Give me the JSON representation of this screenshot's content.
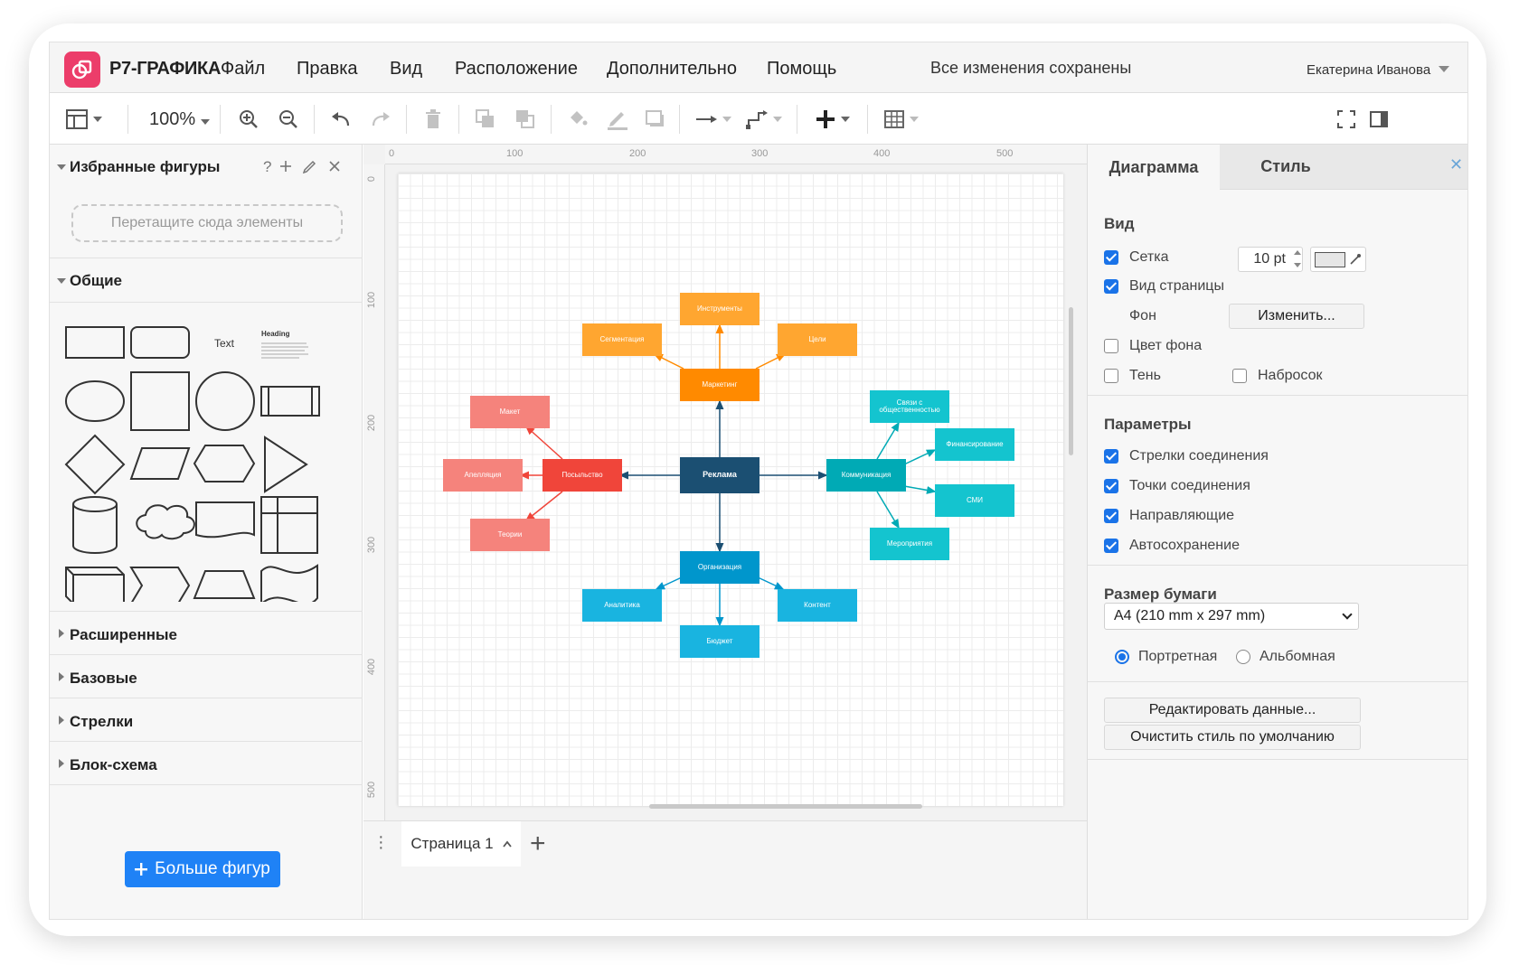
{
  "app": {
    "name": "Р7-ГРАФИКА",
    "save_status": "Все изменения сохранены",
    "user_name": "Екатерина Иванова"
  },
  "menu": [
    "Файл",
    "Правка",
    "Вид",
    "Расположение",
    "Дополнительно",
    "Помощь"
  ],
  "toolbar": {
    "zoom": "100%"
  },
  "left_panel": {
    "favorites_title": "Избранные фигуры",
    "help_glyph": "?",
    "drop_placeholder": "Перетащите сюда элементы",
    "general_title": "Общие",
    "text_shape_label": "Text",
    "heading_shape_label": "Heading",
    "collapsed_sections": [
      "Расширенные",
      "Базовые",
      "Стрелки",
      "Блок-схема"
    ],
    "more_shapes_button": "Больше фигур"
  },
  "ruler": {
    "top": [
      "0",
      "100",
      "200",
      "300",
      "400",
      "500"
    ],
    "left": [
      "0",
      "100",
      "200",
      "300",
      "400",
      "500"
    ]
  },
  "diagram": {
    "center": "Реклама",
    "marketing": "Маркетинг",
    "marketing_children": [
      "Инструменты",
      "Сегментация",
      "Цели"
    ],
    "message": "Посыльство",
    "message_children": [
      "Макет",
      "Апелляция",
      "Теории"
    ],
    "communication": "Коммуникация",
    "communication_children": [
      "Связи с общественностью",
      "Финансирование",
      "СМИ",
      "Мероприятия"
    ],
    "organization": "Организация",
    "organization_children": [
      "Аналитика",
      "Бюджет",
      "Контент"
    ],
    "colors": {
      "center": "#1b4f72",
      "marketing": "#ff8a00",
      "marketing_child": "#ffa630",
      "message": "#f0453a",
      "message_child": "#f5837c",
      "communication": "#00aab5",
      "communication_child": "#14c4cf",
      "organization": "#0096cc",
      "organization_child": "#19b4e0"
    }
  },
  "page_tabs": {
    "current": "Страница 1"
  },
  "right_panel": {
    "tabs": [
      "Диаграмма",
      "Стиль"
    ],
    "view_title": "Вид",
    "grid_label": "Сетка",
    "grid_checked": true,
    "grid_size": "10 pt",
    "page_view_label": "Вид страницы",
    "page_view_checked": true,
    "background_label": "Фон",
    "change_button": "Изменить...",
    "bg_color_label": "Цвет фона",
    "bg_color_checked": false,
    "shadow_label": "Тень",
    "shadow_checked": false,
    "sketch_label": "Набросок",
    "sketch_checked": false,
    "params_title": "Параметры",
    "params": [
      {
        "label": "Стрелки соединения",
        "checked": true
      },
      {
        "label": "Точки соединения",
        "checked": true
      },
      {
        "label": "Направляющие",
        "checked": true
      },
      {
        "label": "Автосохранение",
        "checked": true
      }
    ],
    "paper_title": "Размер бумаги",
    "paper_size": "A4 (210 mm x 297 mm)",
    "portrait_label": "Портретная",
    "landscape_label": "Альбомная",
    "orientation": "portrait",
    "edit_data_button": "Редактировать данные...",
    "clear_style_button": "Очистить стиль по умолчанию"
  }
}
